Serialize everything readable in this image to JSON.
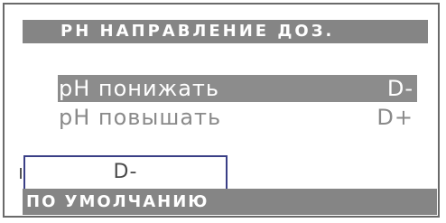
{
  "screen": {
    "title": "PH НАПРАВЛЕНИЕ ДОЗ."
  },
  "options": [
    {
      "label": "pH понижать",
      "code": "D-",
      "selected": true
    },
    {
      "label": "pH повышать",
      "code": "D+",
      "selected": false
    }
  ],
  "current": {
    "value": "D-"
  },
  "footer": {
    "label": "ПО УМОЛЧАНИЮ"
  },
  "colors": {
    "bar_gray": "#858585",
    "highlight_gray": "#8c8c8c",
    "text_gray": "#8a8a8a",
    "frame": "#6a6a6a",
    "box_border": "#3a3f86",
    "background": "#ffffff"
  }
}
